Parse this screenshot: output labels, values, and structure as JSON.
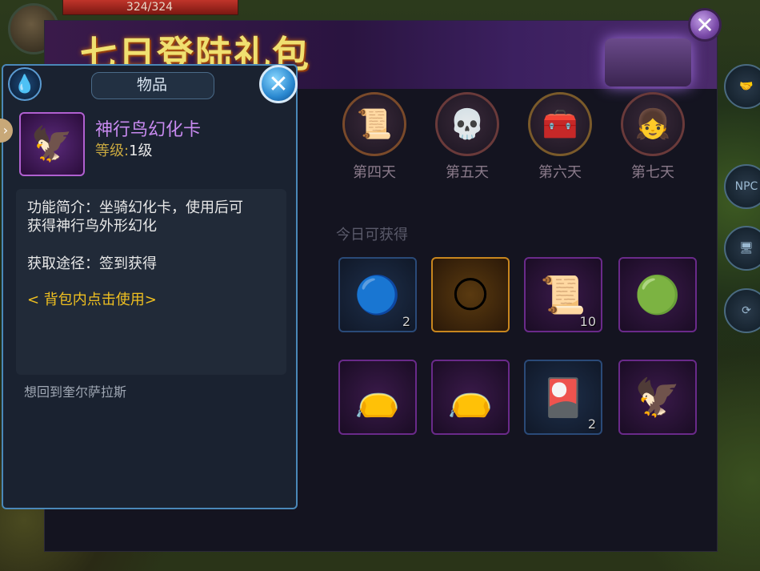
{
  "hud": {
    "hp_text": "324/324"
  },
  "banner": {
    "title": "七日登陆礼包"
  },
  "days": [
    {
      "label": "第四天",
      "icon": "scroll-icon",
      "glyph": "📜"
    },
    {
      "label": "第五天",
      "icon": "armor-icon",
      "glyph": "💀"
    },
    {
      "label": "第六天",
      "icon": "treasure-chest-icon",
      "glyph": "🧰"
    },
    {
      "label": "第七天",
      "icon": "girl-portrait-icon",
      "glyph": "👧"
    }
  ],
  "today": {
    "label": "今日可获得",
    "items": [
      {
        "icon": "blue-orb-icon",
        "glyph": "🔵",
        "count": "2",
        "quality": "blue"
      },
      {
        "icon": "light-sphere-icon",
        "glyph": "🌕",
        "count": "",
        "quality": "orange"
      },
      {
        "icon": "gold-scroll-icon",
        "glyph": "📜",
        "count": "10",
        "quality": "purple"
      },
      {
        "icon": "green-orb-icon",
        "glyph": "🟢",
        "count": "",
        "quality": "purple"
      },
      {
        "icon": "red-pouch-icon",
        "glyph": "👝",
        "count": "",
        "quality": "purple"
      },
      {
        "icon": "blue-pouch-icon",
        "glyph": "👝",
        "count": "",
        "quality": "purple"
      },
      {
        "icon": "token-card-icon",
        "glyph": "🎴",
        "count": "2",
        "quality": "blue"
      },
      {
        "icon": "bird-mount-icon",
        "glyph": "🦅",
        "count": "",
        "quality": "purple"
      }
    ]
  },
  "tooltip": {
    "title": "物品",
    "item_name": "神行鸟幻化卡",
    "level_key": "等级:",
    "level_value": "1级",
    "desc_line1": "功能简介：坐骑幻化卡，使用后可",
    "desc_line2": "获得神行鸟外形幻化",
    "source": "获取途径：签到获得",
    "use_hint": "< 背包内点击使用>",
    "flavor": "想回到奎尔萨拉斯"
  },
  "side": {
    "npc_label": "NPC"
  },
  "colors": {
    "accent_blue": "#4a88b8",
    "purple_name": "#c88af0",
    "gold_hint": "#f0c020"
  }
}
